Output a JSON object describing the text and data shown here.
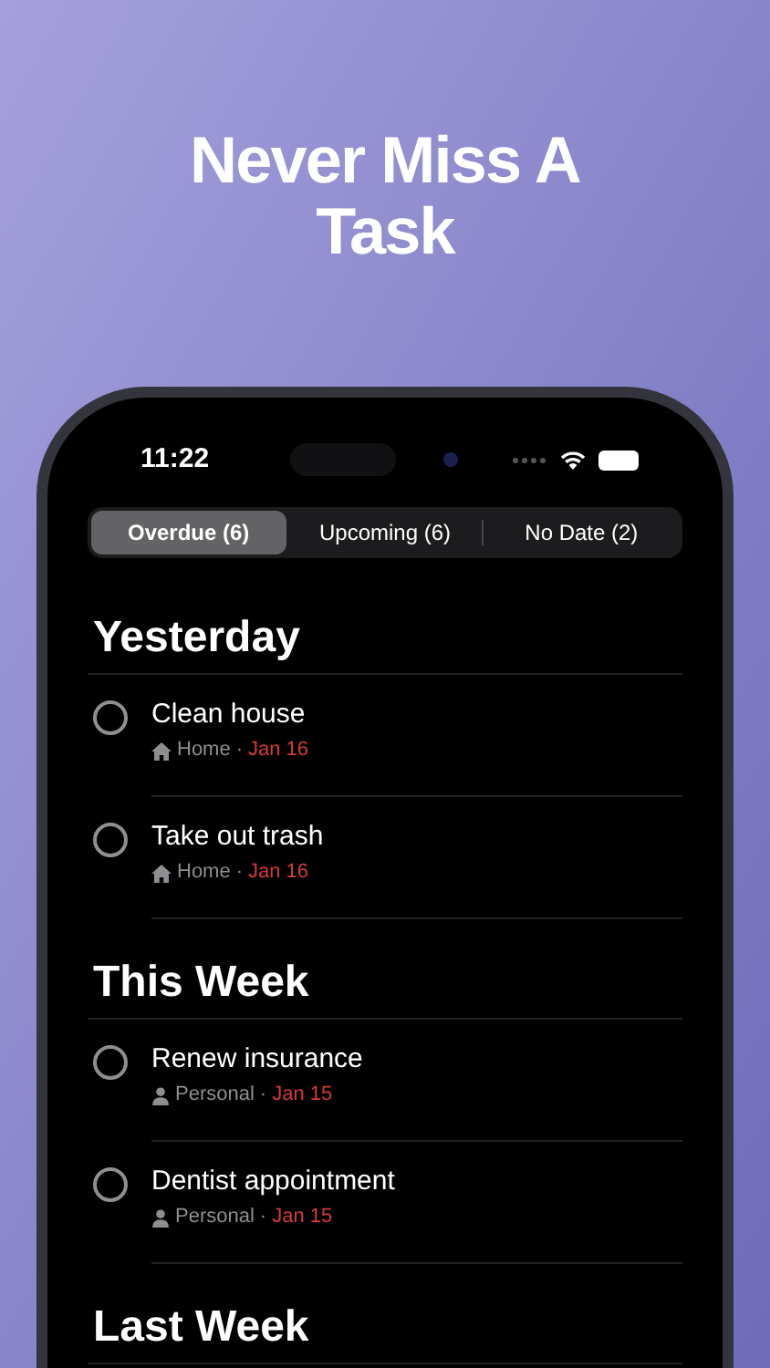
{
  "headline": "Never Miss A Task",
  "status_bar": {
    "time": "11:22"
  },
  "tabs": [
    {
      "label": "Overdue (6)",
      "selected": true
    },
    {
      "label": "Upcoming (6)",
      "selected": false
    },
    {
      "label": "No Date (2)",
      "selected": false
    }
  ],
  "sections": [
    {
      "title": "Yesterday",
      "tasks": [
        {
          "title": "Clean house",
          "kind": "home",
          "list": "Home",
          "separator": "·",
          "due": "Jan 16",
          "checked": false
        },
        {
          "title": "Take out trash",
          "kind": "home",
          "list": "Home",
          "separator": "·",
          "due": "Jan 16",
          "checked": false
        }
      ]
    },
    {
      "title": "This Week",
      "tasks": [
        {
          "title": "Renew insurance",
          "kind": "person",
          "list": "Personal",
          "separator": "·",
          "due": "Jan 15",
          "checked": false
        },
        {
          "title": "Dentist appointment",
          "kind": "person",
          "list": "Personal",
          "separator": "·",
          "due": "Jan 15",
          "checked": false
        }
      ]
    },
    {
      "title": "Last Week"
    }
  ]
}
